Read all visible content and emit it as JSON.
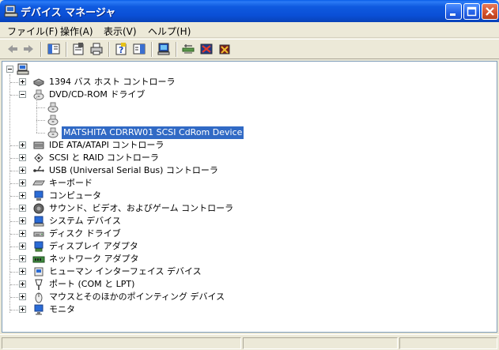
{
  "window": {
    "title": "デバイス マネージャ",
    "title_icon": "computer-icon"
  },
  "menu": [
    {
      "label": "ファイル(F)"
    },
    {
      "label": "操作(A)"
    },
    {
      "label": "表示(V)"
    },
    {
      "label": "ヘルプ(H)"
    }
  ],
  "toolbar": {
    "buttons": [
      "back-arrow-icon",
      "forward-arrow-icon",
      "show-hide-tree-icon",
      "properties-icon",
      "print-icon",
      "help-icon",
      "show-pane-icon",
      "scan-hardware-icon",
      "update-driver-icon",
      "disable-device-icon",
      "uninstall-device-icon"
    ]
  },
  "tree": {
    "root": {
      "label": "",
      "icon": "computer-icon"
    },
    "items": [
      {
        "label": "1394 バス ホスト コントローラ",
        "icon": "1394-controller-icon",
        "expanded": false
      },
      {
        "label": "DVD/CD-ROM ドライブ",
        "icon": "cd-drive-icon",
        "expanded": true
      },
      {
        "label": "",
        "icon": "cd-drive-icon",
        "child": true
      },
      {
        "label": "",
        "icon": "cd-drive-icon",
        "child": true
      },
      {
        "label": "MATSHITA CDRRW01 SCSI CdRom Device",
        "icon": "cd-drive-icon",
        "child": true,
        "selected": true
      },
      {
        "label": "IDE ATA/ATAPI コントローラ",
        "icon": "ide-controller-icon",
        "expanded": false
      },
      {
        "label": "SCSI と RAID コントローラ",
        "icon": "scsi-controller-icon",
        "expanded": false
      },
      {
        "label": "USB (Universal Serial Bus) コントローラ",
        "icon": "usb-icon",
        "expanded": false
      },
      {
        "label": "キーボード",
        "icon": "keyboard-icon",
        "expanded": false
      },
      {
        "label": "コンピュータ",
        "icon": "computer-monitor-icon",
        "expanded": false
      },
      {
        "label": "サウンド、ビデオ、およびゲーム コントローラ",
        "icon": "speaker-icon",
        "expanded": false
      },
      {
        "label": "システム デバイス",
        "icon": "system-device-icon",
        "expanded": false
      },
      {
        "label": "ディスク ドライブ",
        "icon": "disk-drive-icon",
        "expanded": false
      },
      {
        "label": "ディスプレイ アダプタ",
        "icon": "display-adapter-icon",
        "expanded": false
      },
      {
        "label": "ネットワーク アダプタ",
        "icon": "network-adapter-icon",
        "expanded": false
      },
      {
        "label": "ヒューマン インターフェイス デバイス",
        "icon": "hid-icon",
        "expanded": false
      },
      {
        "label": "ポート (COM と LPT)",
        "icon": "port-icon",
        "expanded": false
      },
      {
        "label": "マウスとそのほかのポインティング デバイス",
        "icon": "mouse-icon",
        "expanded": false
      },
      {
        "label": "モニタ",
        "icon": "monitor-icon",
        "expanded": false
      }
    ]
  },
  "colors": {
    "titlebar": "#0a4fd6",
    "selection": "#316ac5",
    "window_bg": "#ece9d8"
  }
}
